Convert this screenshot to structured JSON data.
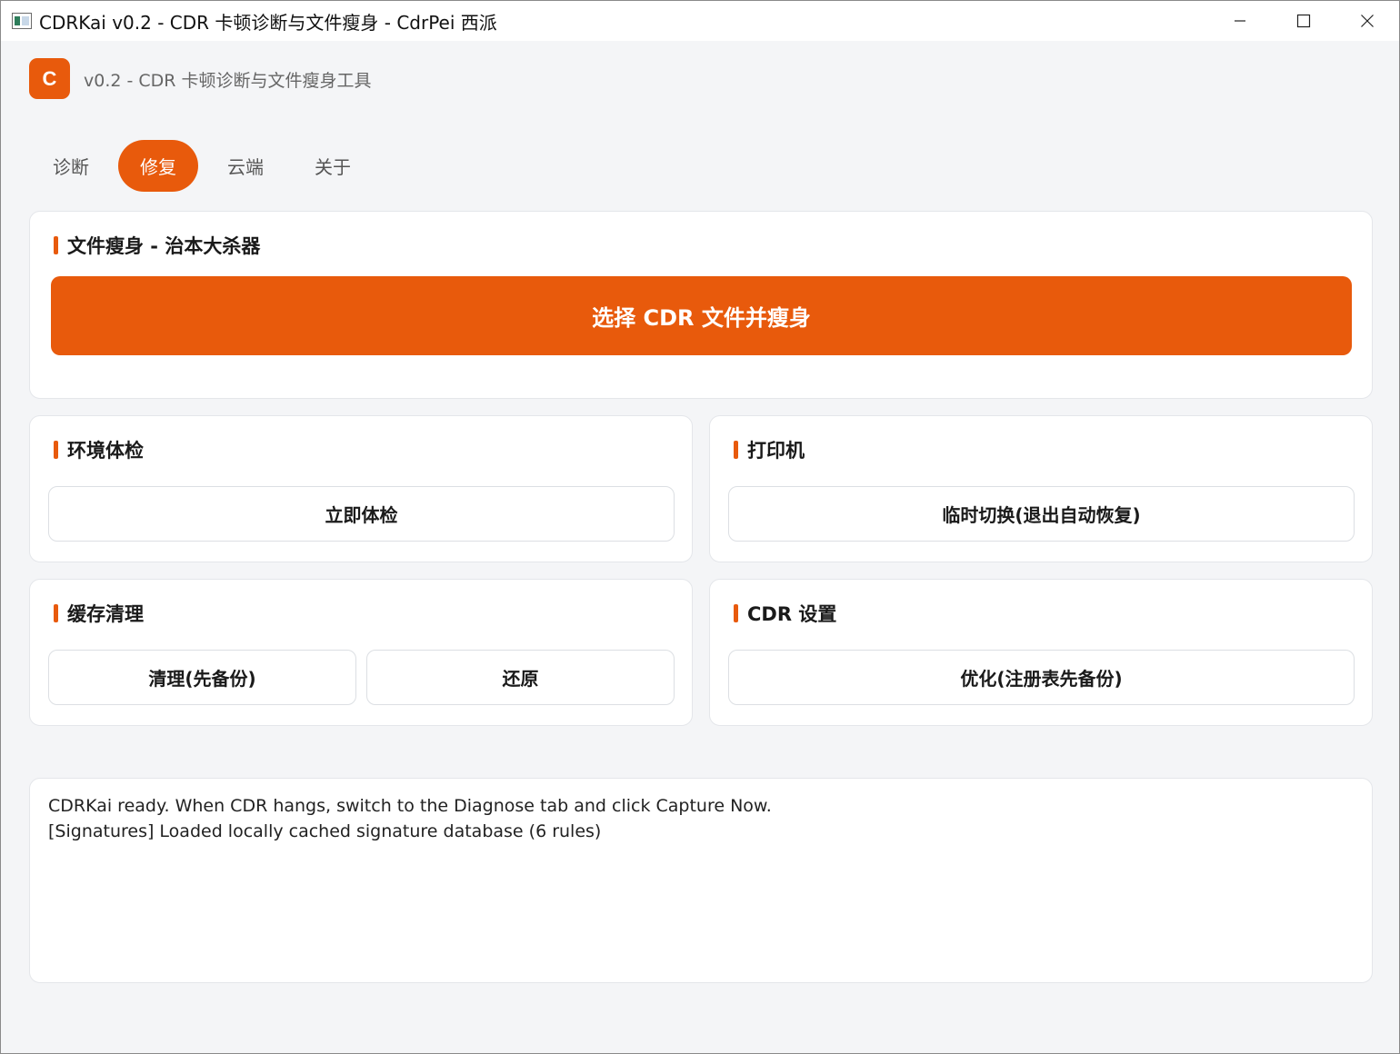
{
  "window": {
    "title": "CDRKai v0.2 - CDR 卡顿诊断与文件瘦身 - CdrPei 西派",
    "minimize": "—",
    "maximize": "☐",
    "close": "✕"
  },
  "header": {
    "logo_letter": "C",
    "subtitle": "v0.2 - CDR 卡顿诊断与文件瘦身工具"
  },
  "tabs": [
    {
      "label": "诊断",
      "active": false
    },
    {
      "label": "修复",
      "active": true
    },
    {
      "label": "云端",
      "active": false
    },
    {
      "label": "关于",
      "active": false
    }
  ],
  "slim_card": {
    "title": "文件瘦身 - 治本大杀器",
    "button": "选择 CDR 文件并瘦身"
  },
  "env_card": {
    "title": "环境体检",
    "button": "立即体检"
  },
  "printer_card": {
    "title": "打印机",
    "button": "临时切换(退出自动恢复)"
  },
  "cache_card": {
    "title": "缓存清理",
    "clean_button": "清理(先备份)",
    "restore_button": "还原"
  },
  "cdr_card": {
    "title": "CDR 设置",
    "button": "优化(注册表先备份)"
  },
  "log": {
    "lines": [
      "CDRKai ready. When CDR hangs, switch to the Diagnose tab and click Capture Now.",
      "[Signatures] Loaded locally cached signature database (6 rules)"
    ]
  },
  "colors": {
    "accent": "#e85a0c",
    "background": "#f4f5f7",
    "card": "#ffffff"
  }
}
